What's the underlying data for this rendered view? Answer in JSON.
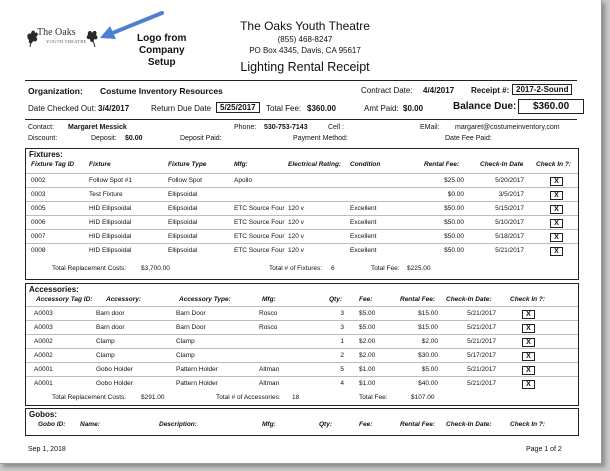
{
  "logo": {
    "name": "The Oaks",
    "subtitle": "YOUTH THEATRE"
  },
  "annotation": {
    "text_line1": "Logo from",
    "text_line2": "Company",
    "text_line3": "Setup"
  },
  "theatre": {
    "name": "The Oaks Youth Theatre",
    "phone": "(855) 468-8247",
    "address": "PO Box 4345, Davis, CA  95617"
  },
  "title": "Lighting Rental Receipt",
  "header": {
    "org_label": "Organization:",
    "org_value": "Costume Inventory Resources",
    "contract_label": "Contract Date:",
    "contract_value": "4/4/2017",
    "receipt_label": "Receipt #:",
    "receipt_value": "2017-2-Sound",
    "checked_out_label": "Date Checked Out:",
    "checked_out_value": "3/4/2017",
    "return_label": "Return Due Date",
    "return_value": "5/25/2017",
    "total_fee_label": "Total Fee:",
    "total_fee_value": "$360.00",
    "amt_paid_label": "Amt Paid:",
    "amt_paid_value": "$0.00",
    "balance_label": "Balance Due:",
    "balance_value": "$360.00"
  },
  "contact": {
    "contact_label": "Contact:",
    "contact_value": "Margaret Messick",
    "phone_label": "Phone:",
    "phone_value": "530-753-7143",
    "cell_label": "Cell :",
    "email_label": "EMail:",
    "email_value": "margaret@costumeinventory.com",
    "discount_label": "Discount:",
    "deposit_label": "Deposit:",
    "deposit_value": "$0.00",
    "deposit_paid_label": "Deposit Paid:",
    "payment_label": "Payment Method:",
    "datefee_label": "Date Fee Paid:"
  },
  "fixtures": {
    "title": "Fixtures:",
    "headers": [
      "Fixture Tag ID",
      "Fixture",
      "Fixture Type",
      "Mfg:",
      "Electrical Rating:",
      "Condition",
      "Rental Fee:",
      "Check-In Date",
      "Check In ?:"
    ],
    "rows": [
      {
        "tag": "0002",
        "fixture": "Follow Spot #1",
        "type": "Follow Spot",
        "mfg": "Apollo",
        "rating": "",
        "condition": "",
        "fee": "$25.00",
        "checkin": "5/20/2017",
        "checked": "X"
      },
      {
        "tag": "0003",
        "fixture": "Test Fixture",
        "type": "Ellipsoidal",
        "mfg": "",
        "rating": "",
        "condition": "",
        "fee": "$0.00",
        "checkin": "3/5/2017",
        "checked": "X"
      },
      {
        "tag": "0005",
        "fixture": "HID Ellipsoidal",
        "type": "Ellipsoidal",
        "mfg": "ETC Source Four",
        "rating": "120 v",
        "condition": "Excellent",
        "fee": "$50.00",
        "checkin": "5/15/2017",
        "checked": "X"
      },
      {
        "tag": "0006",
        "fixture": "HID Ellipsoidal",
        "type": "Ellipsoidal",
        "mfg": "ETC Source Four",
        "rating": "120 v",
        "condition": "Excellent",
        "fee": "$50.00",
        "checkin": "5/10/2017",
        "checked": "X"
      },
      {
        "tag": "0007",
        "fixture": "HID Ellipsoidal",
        "type": "Ellipsoidal",
        "mfg": "ETC Source Four",
        "rating": "120 v",
        "condition": "Excellent",
        "fee": "$50.00",
        "checkin": "5/18/2017",
        "checked": "X"
      },
      {
        "tag": "0008",
        "fixture": "HID Ellipsoidal",
        "type": "Ellipsoidal",
        "mfg": "ETC Source Four",
        "rating": "120 v",
        "condition": "Excellent",
        "fee": "$50.00",
        "checkin": "5/21/2017",
        "checked": "X"
      }
    ],
    "totals": {
      "replacement_label": "Total Replacement Costs:",
      "replacement_value": "$3,700.00",
      "count_label": "Total # of Fixtures:",
      "count_value": "6",
      "fee_label": "Total Fee:",
      "fee_value": "$225.00"
    }
  },
  "accessories": {
    "title": "Accessories:",
    "headers": [
      "Accessory Tag ID:",
      "Accessory:",
      "Accessory Type:",
      "Mfg:",
      "Qty:",
      "Fee:",
      "Rental Fee:",
      "Check-In Date:",
      "Check In ?:"
    ],
    "rows": [
      {
        "tag": "A0003",
        "name": "Barn door",
        "type": "Barn Door",
        "mfg": "Rosco",
        "qty": "3",
        "fee": "$5.00",
        "rental": "$15.00",
        "checkin": "5/21/2017",
        "checked": "X"
      },
      {
        "tag": "A0003",
        "name": "Barn door",
        "type": "Barn Door",
        "mfg": "Rosco",
        "qty": "3",
        "fee": "$5.00",
        "rental": "$15.00",
        "checkin": "5/21/2017",
        "checked": "X"
      },
      {
        "tag": "A0002",
        "name": "Clamp",
        "type": "Clamp",
        "mfg": "",
        "qty": "1",
        "fee": "$2.00",
        "rental": "$2.00",
        "checkin": "5/21/2017",
        "checked": "X"
      },
      {
        "tag": "A0002",
        "name": "Clamp",
        "type": "Clamp",
        "mfg": "",
        "qty": "2",
        "fee": "$2.00",
        "rental": "$30.00",
        "checkin": "5/17/2017",
        "checked": "X"
      },
      {
        "tag": "A0001",
        "name": "Gobo Holder",
        "type": "Pattern Holder",
        "mfg": "Altman",
        "qty": "5",
        "fee": "$1.00",
        "rental": "$5.00",
        "checkin": "5/21/2017",
        "checked": "X"
      },
      {
        "tag": "A0001",
        "name": "Gobo Holder",
        "type": "Pattern Holder",
        "mfg": "Altman",
        "qty": "4",
        "fee": "$1.00",
        "rental": "$40.00",
        "checkin": "5/21/2017",
        "checked": "X"
      }
    ],
    "totals": {
      "replacement_label": "Total Replacement Costs:",
      "replacement_value": "$291.00",
      "count_label": "Total # of Accessories:",
      "count_value": "18",
      "fee_label": "Total Fee:",
      "fee_value": "$107.00"
    }
  },
  "gobos": {
    "title": "Gobos:",
    "headers": [
      "Gobo ID:",
      "Name:",
      "Description:",
      "Mfg:",
      "Qty:",
      "Fee:",
      "Rental Fee:",
      "Check-In Date:",
      "Check In ?:"
    ]
  },
  "footer": {
    "date": "Sep 1, 2018",
    "page": "Page 1 of 2"
  },
  "colors": {
    "arrow": "#4f7fd0"
  }
}
